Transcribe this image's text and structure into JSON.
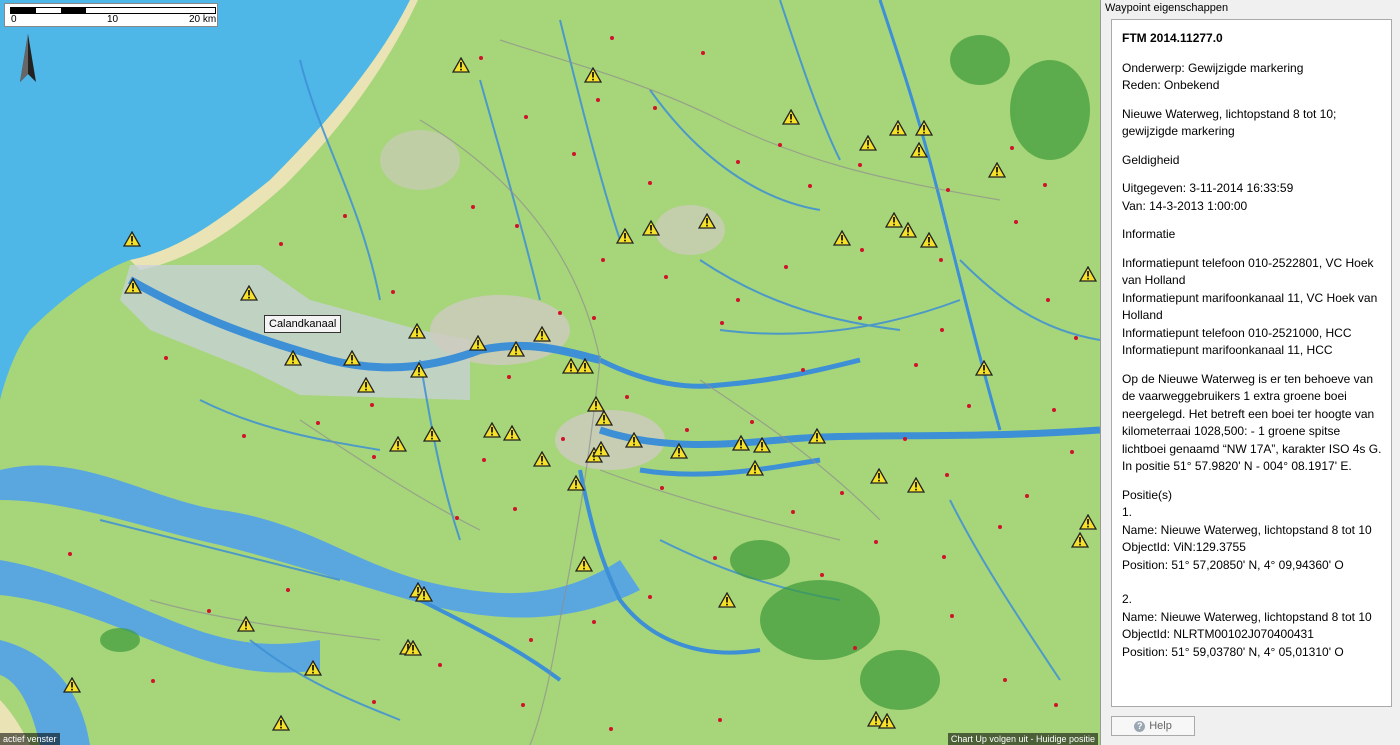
{
  "map": {
    "scale": {
      "labels": [
        "0",
        "10",
        "20 km"
      ]
    },
    "tooltip": "Calandkanaal",
    "status_left": "actief venster",
    "status_right": "Chart Up volgen uit - Huidige positie",
    "warning_icon": "warning-triangle-icon",
    "colors": {
      "sea": "#4fb7e8",
      "land": "#a7d57a",
      "water": "#3d8fd6",
      "marker": "#d0122a"
    }
  },
  "panel": {
    "title": "Waypoint eigenschappen",
    "heading": "FTM 2014.11277.0",
    "subject": "Onderwerp: Gewijzigde markering",
    "reason": "Reden: Onbekend",
    "location": "Nieuwe Waterweg, lichtopstand 8 tot 10; gewijzigde markering",
    "validity_heading": "Geldigheid",
    "issued": "Uitgegeven: 3-11-2014 16:33:59",
    "from": "Van: 14-3-2013 1:00:00",
    "info_heading": "Informatie",
    "info_lines": [
      "Informatiepunt telefoon 010-2522801, VC Hoek van Holland",
      "Informatiepunt marifoonkanaal 11, VC Hoek van Holland",
      "Informatiepunt telefoon 010-2521000, HCC",
      "Informatiepunt marifoonkanaal 11, HCC"
    ],
    "description": "Op de Nieuwe Waterweg is er ten behoeve van de vaarweggebruikers 1 extra groene boei neergelegd. Het betreft een boei ter hoogte van kilometerraai 1028,500: - 1 groene spitse lichtboei genaamd “NW 17A”, karakter ISO 4s G. In positie 51° 57.9820' N - 004° 08.1917' E.",
    "positions_heading": "Positie(s)",
    "positions": [
      {
        "index": "1.",
        "name": "Name: Nieuwe Waterweg, lichtopstand 8 tot 10",
        "object_id": "ObjectId: ViN:129.3755",
        "position": "Position: 51° 57,20850' N, 4° 09,94360' O"
      },
      {
        "index": "2.",
        "name": "Name: Nieuwe Waterweg, lichtopstand 8 tot 10",
        "object_id": "ObjectId: NLRTM00102J070400431",
        "position": "Position: 51° 59,03780' N, 4° 05,01310' O"
      }
    ],
    "help_label": "Help"
  }
}
